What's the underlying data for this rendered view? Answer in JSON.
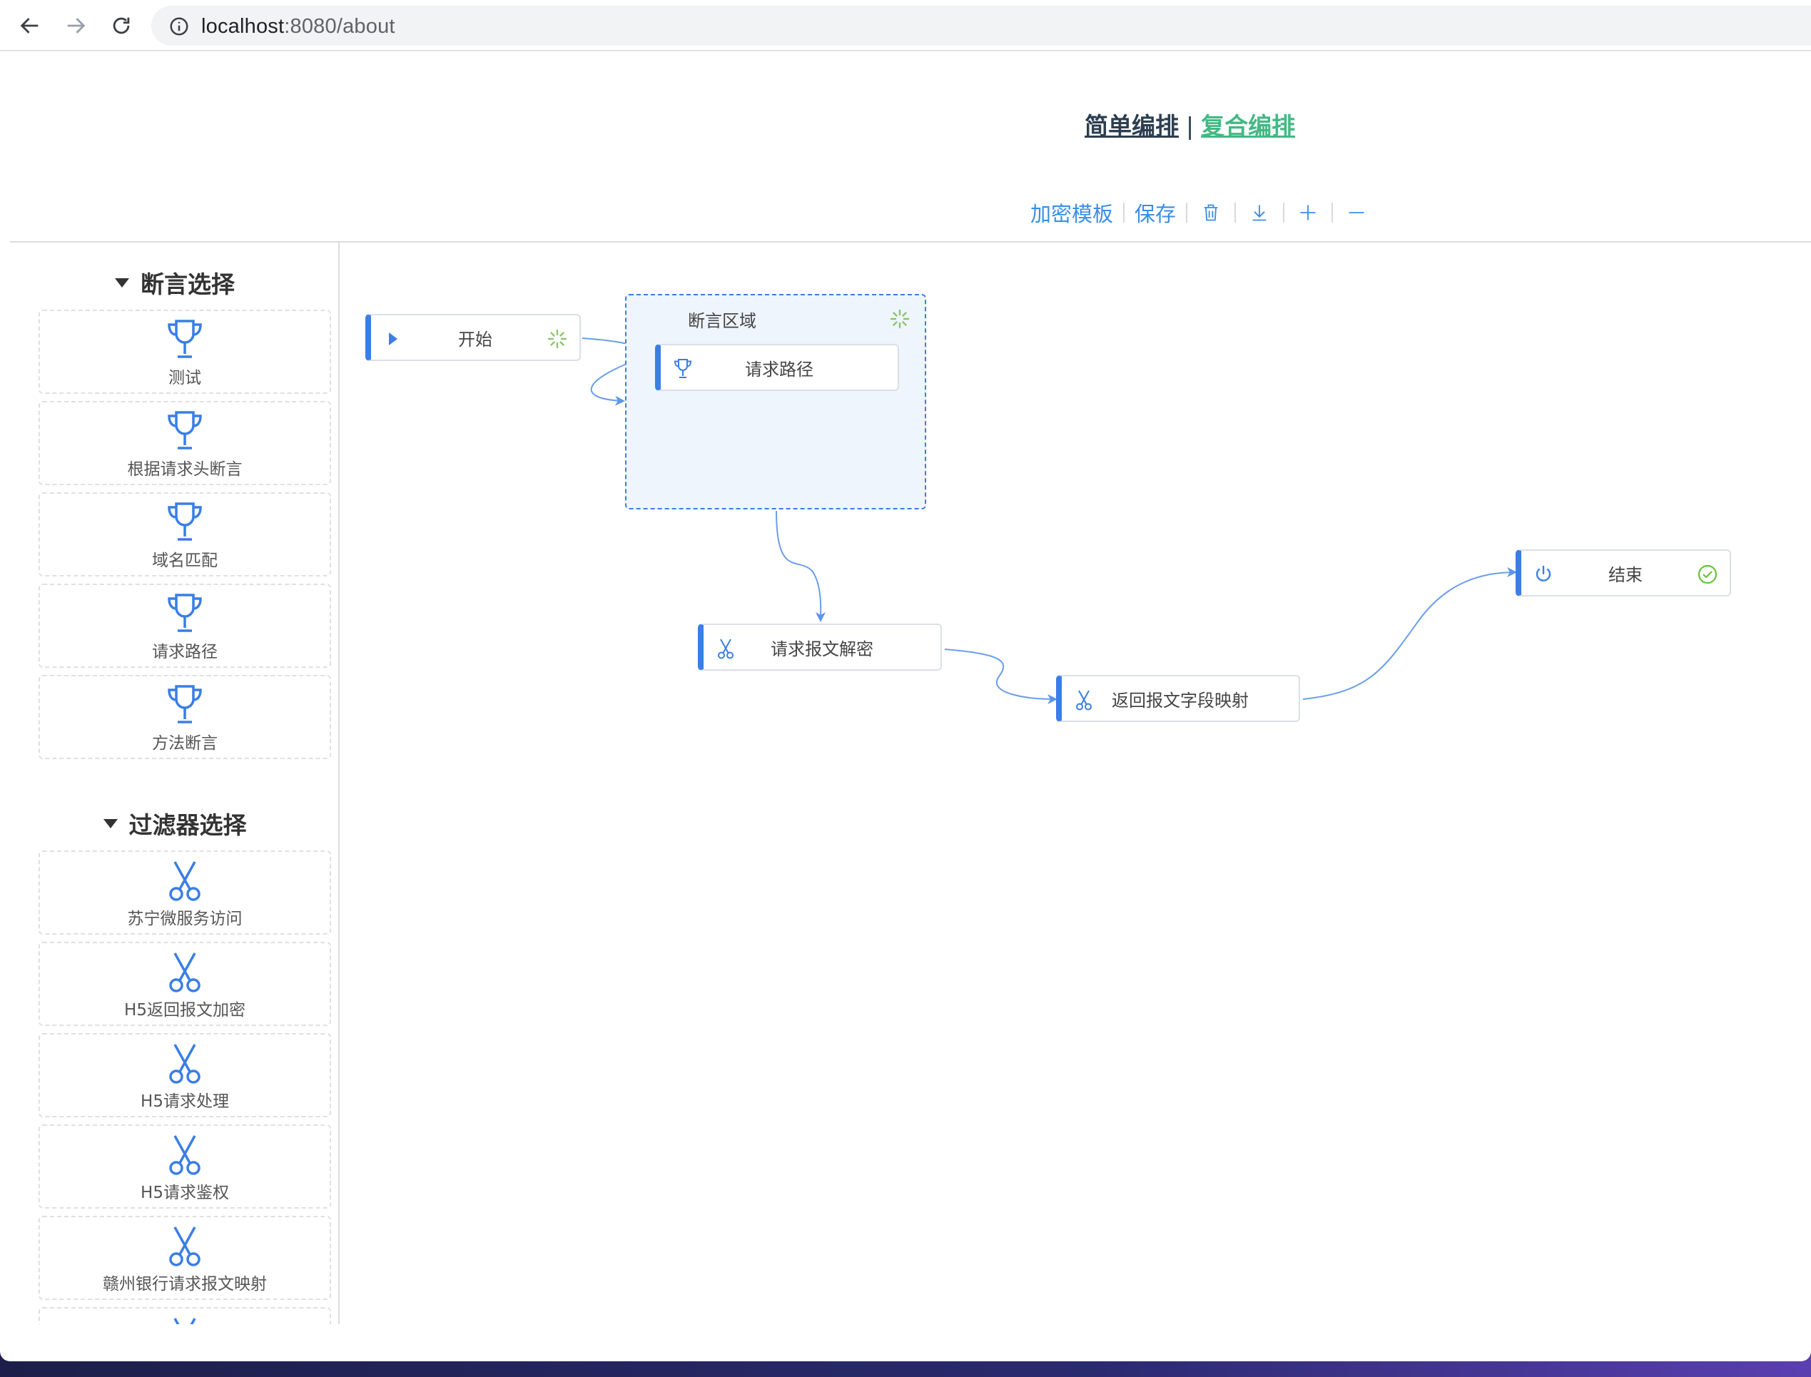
{
  "browser": {
    "url_host": "localhost",
    "url_path": ":8080/about"
  },
  "header": {
    "mode_simple": "简单编排",
    "mode_separator": "|",
    "mode_complex": "复合编排"
  },
  "toolbar": {
    "encrypt_template": "加密模板",
    "save": "保存",
    "icons": [
      "trash-icon",
      "download-icon",
      "zoom-in-icon",
      "zoom-out-icon"
    ]
  },
  "sidebar": {
    "assert_section": {
      "title": "断言选择",
      "items": [
        {
          "label": "测试",
          "icon": "trophy-icon"
        },
        {
          "label": "根据请求头断言",
          "icon": "trophy-icon"
        },
        {
          "label": "域名匹配",
          "icon": "trophy-icon"
        },
        {
          "label": "请求路径",
          "icon": "trophy-icon"
        },
        {
          "label": "方法断言",
          "icon": "trophy-icon"
        }
      ]
    },
    "filter_section": {
      "title": "过滤器选择",
      "items": [
        {
          "label": "苏宁微服务访问",
          "icon": "scissors-icon"
        },
        {
          "label": "H5返回报文加密",
          "icon": "scissors-icon"
        },
        {
          "label": "H5请求处理",
          "icon": "scissors-icon"
        },
        {
          "label": "H5请求鉴权",
          "icon": "scissors-icon"
        },
        {
          "label": "赣州银行请求报文映射",
          "icon": "scissors-icon"
        }
      ]
    }
  },
  "canvas": {
    "group": {
      "title": "断言区域",
      "status_icon": "loading-icon"
    },
    "nodes": {
      "start": {
        "label": "开始",
        "icon": "play-icon",
        "status_icon": "loading-icon"
      },
      "request_path": {
        "label": "请求路径",
        "icon": "trophy-icon"
      },
      "decrypt": {
        "label": "请求报文解密",
        "icon": "scissors-icon"
      },
      "mapping": {
        "label": "返回报文字段映射",
        "icon": "scissors-icon"
      },
      "end": {
        "label": "结束",
        "icon": "power-icon",
        "status_icon": "check-circle-icon"
      }
    }
  },
  "colors": {
    "accent": "#3a7ee6",
    "link_complex": "#42b983",
    "group_fill": "#eff5fd",
    "success": "#67c23a"
  }
}
